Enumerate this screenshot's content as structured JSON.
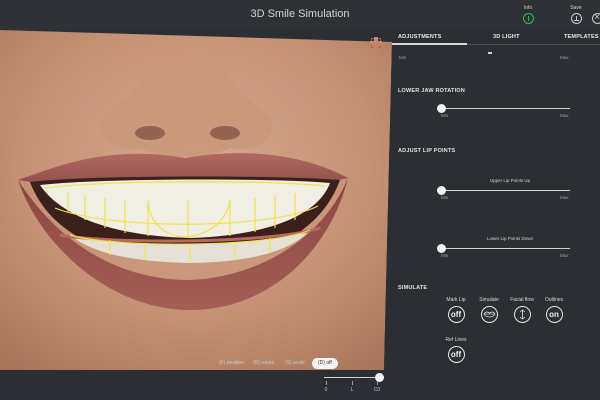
{
  "app": {
    "title": "3D Smile Simulation"
  },
  "toolbar": {
    "info_label": "Info",
    "save_label": "Save",
    "close_label": ""
  },
  "photo": {
    "alt": "smile"
  },
  "view_buttons": [
    {
      "label": "(F) position",
      "active": false
    },
    {
      "label": "(R) rotate",
      "active": false
    },
    {
      "label": "(S) scale",
      "active": false
    },
    {
      "label": "(D) off",
      "active": true
    }
  ],
  "zoom": {
    "labels": [
      "0",
      "L",
      "C0"
    ],
    "value": 1.0
  },
  "tabs": [
    {
      "label": "ADJUSTMENTS",
      "active": true
    },
    {
      "label": "3D LIGHT",
      "active": false
    },
    {
      "label": "TEMPLATES",
      "active": false
    }
  ],
  "adjustments": {
    "top_minmax": {
      "min": "Min",
      "max": "Max"
    },
    "lower_jaw": {
      "title": "LOWER JAW ROTATION",
      "min": "Min",
      "max": "Max",
      "value": 0.0
    },
    "lip_points": {
      "title": "ADJUST LIP POINTS",
      "up": {
        "label": "Upper Lip Points Up",
        "min": "Min",
        "max": "Max",
        "value": 0.0
      },
      "down": {
        "label": "Lower Lip Points Down",
        "min": "Min",
        "max": "Max",
        "value": 0.0
      }
    }
  },
  "simulate": {
    "title": "SIMULATE",
    "items": [
      {
        "label": "Mark Lip",
        "state": "off"
      },
      {
        "label": "Simulate",
        "state": ""
      },
      {
        "label": "Facial flow",
        "state": ""
      },
      {
        "label": "Outlines",
        "state": "on"
      },
      {
        "label": "Ref Lines",
        "state": "off"
      }
    ]
  },
  "colors": {
    "accent": "#2fbf4a",
    "panel": "#2b2f33",
    "outline": "#f2e24a"
  }
}
